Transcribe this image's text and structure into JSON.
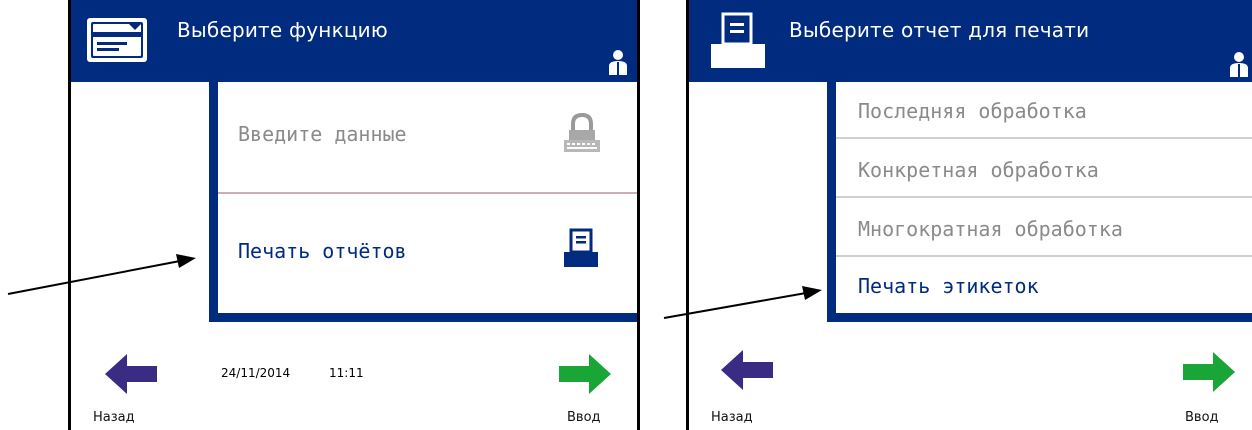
{
  "screen1": {
    "title": "Выберите функцию",
    "menu": [
      {
        "label": "Введите данные",
        "state": "inactive",
        "icon": "lock-keypad-icon"
      },
      {
        "label": "Печать отчётов",
        "state": "active",
        "icon": "printer-icon"
      }
    ],
    "date": "24/11/2014",
    "time": "11:11",
    "back_label": "Назад",
    "enter_label": "Ввод"
  },
  "screen2": {
    "title": "Выберите отчет для печати",
    "menu": [
      {
        "label": "Последняя обработка",
        "state": "inactive"
      },
      {
        "label": "Конкретная обработка",
        "state": "inactive"
      },
      {
        "label": "Многократная обработка",
        "state": "inactive"
      },
      {
        "label": "Печать этикеток",
        "state": "active"
      }
    ],
    "back_label": "Назад",
    "enter_label": "Ввод"
  },
  "colors": {
    "header": "#002b7f",
    "back_arrow": "#3a2c82",
    "enter_arrow": "#1aa637",
    "inactive_text": "#8a8a8a",
    "active_text": "#002b7f"
  }
}
